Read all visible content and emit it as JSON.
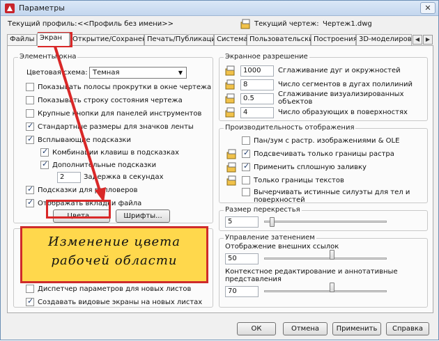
{
  "window": {
    "title": "Параметры",
    "close_glyph": "✕"
  },
  "profile": {
    "current_profile_label": "Текущий профиль:",
    "current_profile_value": "<<Профиль без имени>>",
    "current_drawing_label": "Текущий чертеж:",
    "current_drawing_value": "Чертеж1.dwg"
  },
  "tabs": [
    {
      "label": "Файлы"
    },
    {
      "label": "Экран"
    },
    {
      "label": "Открытие/Сохранение"
    },
    {
      "label": "Печать/Публикация"
    },
    {
      "label": "Система"
    },
    {
      "label": "Пользовательские"
    },
    {
      "label": "Построения"
    },
    {
      "label": "3D-моделирова"
    }
  ],
  "window_elements": {
    "title": "Элементы окна",
    "color_scheme_label": "Цветовая схема:",
    "color_scheme_value": "Темная",
    "checkboxes": [
      {
        "label": "Показывать полосы прокрутки в окне чертежа",
        "checked": false
      },
      {
        "label": "Показывать строку состояния чертежа",
        "checked": false
      },
      {
        "label": "Крупные кнопки для панелей инструментов",
        "checked": false
      },
      {
        "label": "Стандартные размеры для значков ленты",
        "checked": true
      },
      {
        "label": "Всплывающие подсказки",
        "checked": true
      },
      {
        "label": "Комбинации клавиш в подсказках",
        "checked": true
      },
      {
        "label": "Дополнительные подсказки",
        "checked": true
      },
      {
        "label": "Подсказки для ролловеров",
        "checked": true
      },
      {
        "label": "Отображать вкладки файла",
        "checked": true
      }
    ],
    "delay_value": "2",
    "delay_label": "Задержка в секундах",
    "colors_button": "Цвета...",
    "fonts_button": "Шрифты..."
  },
  "bottom_checkboxes": [
    {
      "label": "Диспетчер параметров для новых листов",
      "checked": false
    },
    {
      "label": "Создавать видовые экраны на новых листах",
      "checked": true
    }
  ],
  "display_resolution": {
    "title": "Экранное разрешение",
    "rows": [
      {
        "value": "1000",
        "label": "Сглаживание дуг и окружностей"
      },
      {
        "value": "8",
        "label": "Число сегментов в дугах полилиний"
      },
      {
        "value": "0.5",
        "label": "Сглаживание визуализированных",
        "label2": "объектов"
      },
      {
        "value": "4",
        "label": "Число образующих в поверхностях"
      }
    ]
  },
  "display_performance": {
    "title": "Производительность отображения",
    "checkboxes": [
      {
        "label": "Пан/зум с растр. изображениями & OLE",
        "checked": false
      },
      {
        "label": "Подсвечивать только границы растра",
        "checked": true
      },
      {
        "label": "Применить сплошную заливку",
        "checked": true
      },
      {
        "label": "Только границы текстов",
        "checked": false
      },
      {
        "label": "Вычерчивать истинные силуэты для тел и",
        "label2": "поверхностей",
        "checked": false
      }
    ]
  },
  "crosshair": {
    "title": "Размер перекрестья",
    "value": "5",
    "level_fraction": 0.05
  },
  "fade_control": {
    "title": "Управление затенением",
    "xref_label": "Отображение внешних ссылок",
    "xref_value": "50",
    "xref_level_fraction": 0.56,
    "inplace_label": "Контекстное редактирование и аннотативные",
    "inplace_label2": "представления",
    "inplace_value": "70",
    "inplace_level_fraction": 0.56
  },
  "callout": {
    "line1": "Изменение цвета",
    "line2": "рабочей области"
  },
  "buttons": {
    "ok": "ОК",
    "cancel": "Отмена",
    "apply": "Применить",
    "help": "Справка"
  },
  "colors": {
    "annotation_red": "#d92828",
    "callout_fill": "#ffd84c",
    "selection_blue": "#3b7dd8"
  }
}
